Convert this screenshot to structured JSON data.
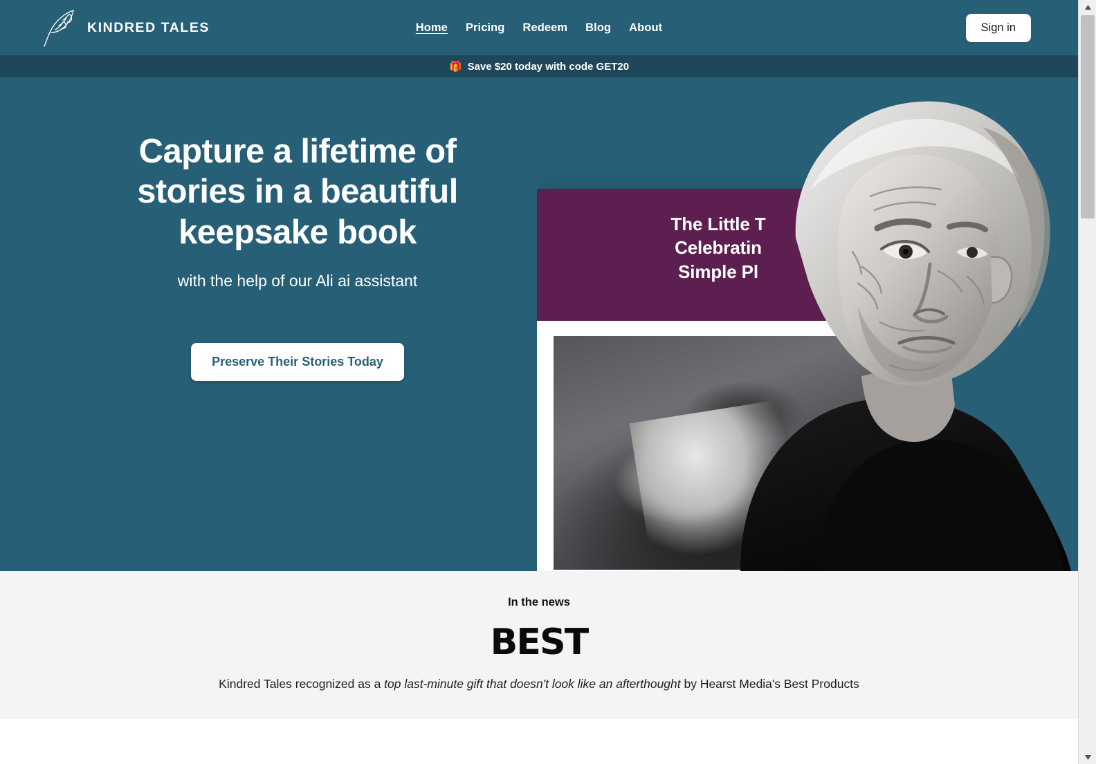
{
  "header": {
    "brand_name": "KINDRED TALES",
    "brand_icon": "feather-quill-icon",
    "nav": [
      {
        "label": "Home",
        "active": true
      },
      {
        "label": "Pricing",
        "active": false
      },
      {
        "label": "Redeem",
        "active": false
      },
      {
        "label": "Blog",
        "active": false
      },
      {
        "label": "About",
        "active": false
      }
    ],
    "signin_label": "Sign in",
    "background_color": "#265f76"
  },
  "promo_banner": {
    "icon": "🎁",
    "text": "Save $20 today with code GET20",
    "background_color": "#1e4759"
  },
  "hero": {
    "title": "Capture a lifetime of stories in a beautiful keepsake book",
    "subtitle": "with the help of our Ali ai assistant",
    "cta_label": "Preserve Their Stories Today",
    "background_color": "#265f76",
    "book_cover_title": "The Little T\nCelebratin\nSimple Pl",
    "book_cover_color": "#5d1f4f",
    "portrait_alt": "elderly-woman-portrait"
  },
  "news": {
    "heading": "In the news",
    "logo_text": "BEST",
    "caption_before": "Kindred Tales recognized as a ",
    "caption_emphasis": "top last-minute gift that doesn't look like an afterthought",
    "caption_after": " by Hearst Media's Best Products",
    "background_color": "#f4f4f4"
  },
  "scrollbar": {
    "up_arrow": "▲",
    "down_arrow": "▼"
  }
}
